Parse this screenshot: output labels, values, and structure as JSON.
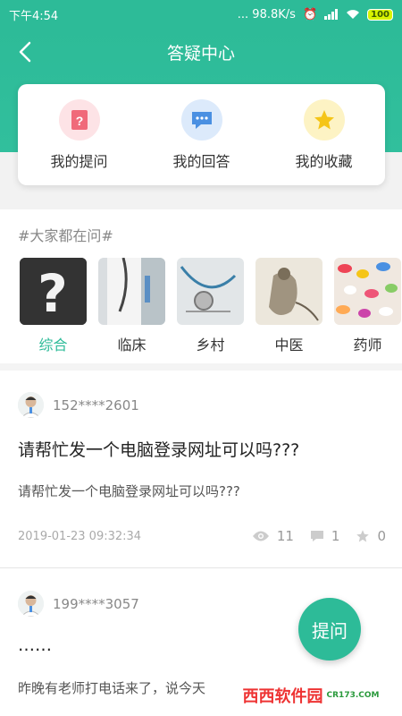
{
  "status_bar": {
    "time": "下午4:54",
    "network_speed": "... 98.8K/s",
    "battery": "100"
  },
  "nav": {
    "title": "答疑中心"
  },
  "quick_actions": [
    {
      "label": "我的提问",
      "icon": "question-doc-icon",
      "color": "#f06a7a"
    },
    {
      "label": "我的回答",
      "icon": "chat-bubble-icon",
      "color": "#4a90e2"
    },
    {
      "label": "我的收藏",
      "icon": "star-icon",
      "color": "#f5c518"
    }
  ],
  "topics": {
    "title": "#大家都在问#",
    "categories": [
      {
        "label": "综合",
        "active": true
      },
      {
        "label": "临床",
        "active": false
      },
      {
        "label": "乡村",
        "active": false
      },
      {
        "label": "中医",
        "active": false
      },
      {
        "label": "药师",
        "active": false
      }
    ]
  },
  "posts": [
    {
      "user": "152****2601",
      "title": "请帮忙发一个电脑登录网址可以吗???",
      "body": "请帮忙发一个电脑登录网址可以吗???",
      "time": "2019-01-23 09:32:34",
      "views": "11",
      "comments": "1",
      "likes": "0"
    },
    {
      "user": "199****3057",
      "title": "……",
      "body": "昨晚有老师打电话来了，说今天"
    }
  ],
  "fab": {
    "label": "提问"
  },
  "watermark": {
    "brand_cn": "西西软件园",
    "url": "CR173.COM"
  },
  "colors": {
    "primary": "#2dbb98"
  }
}
